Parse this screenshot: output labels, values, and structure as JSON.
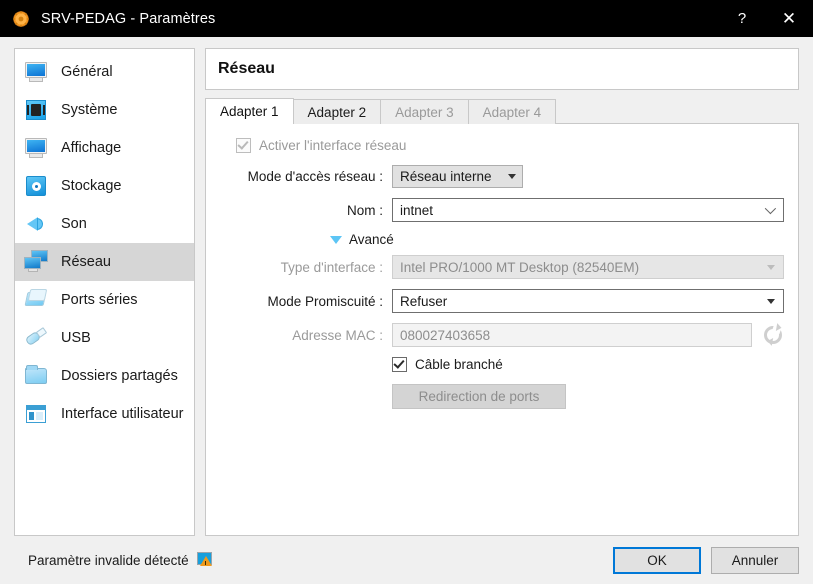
{
  "window": {
    "title": "SRV-PEDAG - Paramètres",
    "icon": "virtualbox-gear-icon",
    "help_label": "?",
    "close_label": "✕"
  },
  "sidebar": {
    "items": [
      {
        "label": "Général",
        "icon": "monitor-icon",
        "selected": false
      },
      {
        "label": "Système",
        "icon": "motherboard-chip-icon",
        "selected": false
      },
      {
        "label": "Affichage",
        "icon": "display-icon",
        "selected": false
      },
      {
        "label": "Stockage",
        "icon": "harddisk-icon",
        "selected": false
      },
      {
        "label": "Son",
        "icon": "speaker-icon",
        "selected": false
      },
      {
        "label": "Réseau",
        "icon": "network-icon",
        "selected": true
      },
      {
        "label": "Ports séries",
        "icon": "serial-ports-icon",
        "selected": false
      },
      {
        "label": "USB",
        "icon": "usb-icon",
        "selected": false
      },
      {
        "label": "Dossiers partagés",
        "icon": "folder-icon",
        "selected": false
      },
      {
        "label": "Interface utilisateur",
        "icon": "ui-window-icon",
        "selected": false
      }
    ]
  },
  "panel": {
    "title": "Réseau",
    "tabs": [
      {
        "label": "Adapter 1",
        "state": "active"
      },
      {
        "label": "Adapter 2",
        "state": "enabled"
      },
      {
        "label": "Adapter 3",
        "state": "disabled"
      },
      {
        "label": "Adapter 4",
        "state": "disabled"
      }
    ]
  },
  "form": {
    "enable_adapter": {
      "label": "Activer l'interface réseau",
      "checked": true,
      "enabled": false
    },
    "attached_to": {
      "label": "Mode d'accès réseau :",
      "value": "Réseau interne",
      "arrow": "chevron-down-icon"
    },
    "name": {
      "label": "Nom :",
      "value": "intnet",
      "arrow": "chevron-down-icon"
    },
    "advanced": {
      "label": "Avancé",
      "arrow": "triangle-down-icon",
      "expanded": true
    },
    "adapter_type": {
      "label": "Type d'interface :",
      "value": "Intel PRO/1000 MT Desktop (82540EM)",
      "enabled": false
    },
    "promiscuous": {
      "label": "Mode Promiscuité :",
      "value": "Refuser",
      "enabled": true
    },
    "mac_address": {
      "label": "Adresse MAC :",
      "value": "080027403658",
      "enabled": false,
      "refresh_icon": "refresh-mac-icon"
    },
    "cable_connected": {
      "label": "Câble branché",
      "checked": true,
      "enabled": true
    },
    "port_forwarding": {
      "label": "Redirection de ports",
      "enabled": false
    }
  },
  "footer": {
    "warning_text": "Paramètre invalide détecté",
    "warning_icon": "invalid-setting-warning-icon",
    "ok_label": "OK",
    "cancel_label": "Annuler"
  },
  "colors": {
    "titlebar_bg": "#000000",
    "dialog_bg": "#f0f0f0",
    "accent_focus": "#0078d7",
    "selection_bg": "#d6d6d6",
    "disabled_text": "#8d8d8d",
    "warning_orange": "#f09a1b"
  }
}
